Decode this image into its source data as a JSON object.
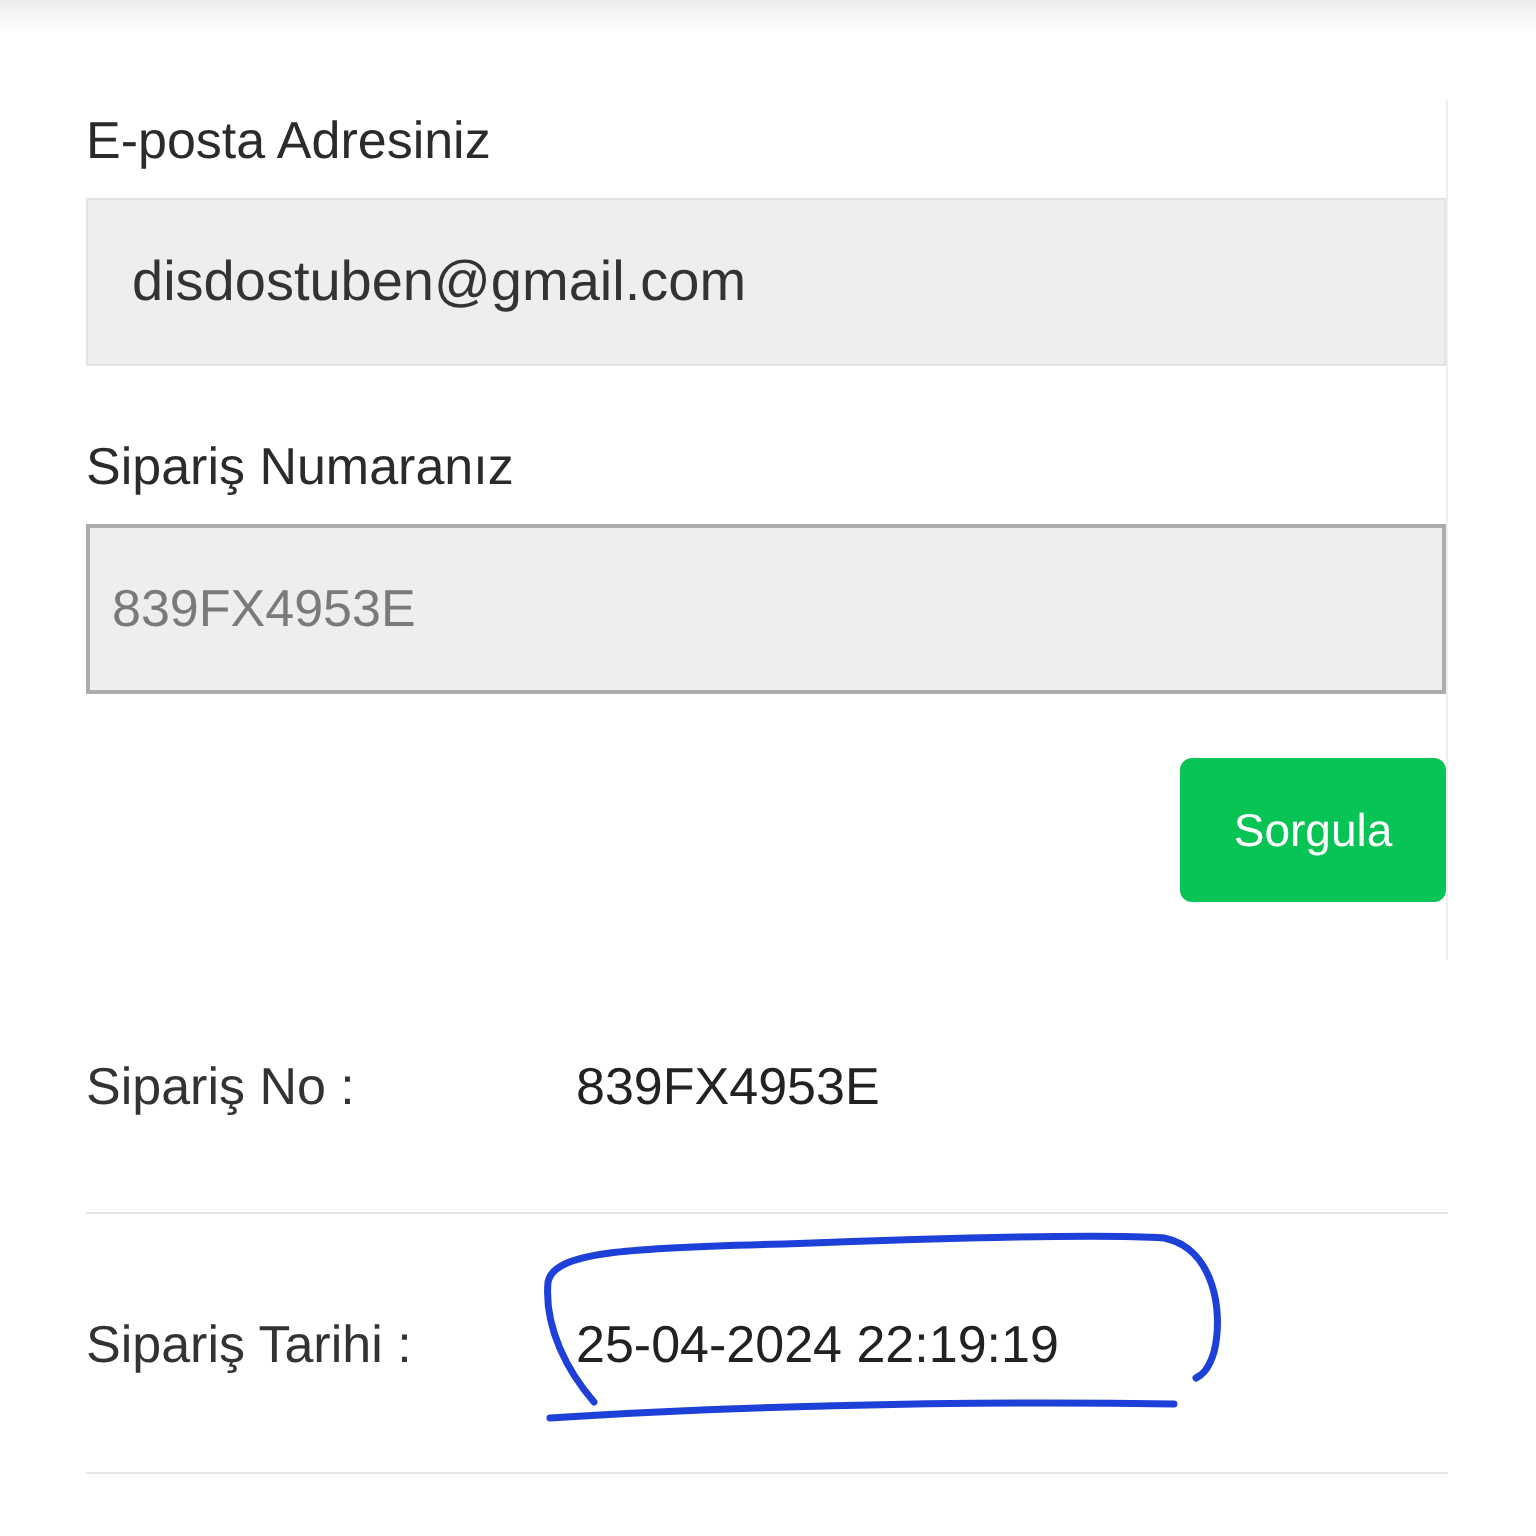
{
  "form": {
    "fields": [
      {
        "kind": "readonly",
        "label": "E-posta Adresiniz",
        "value": "disdostuben@gmail.com"
      },
      {
        "kind": "text",
        "label": "Sipariş Numaranız",
        "placeholder": "839FX4953E"
      }
    ],
    "submit_button": "Sorgula"
  },
  "order_details": [
    {
      "label": "Sipariş No :",
      "value": "839FX4953E",
      "circled": false
    },
    {
      "label": "Sipariş Tarihi :",
      "value": "25-04-2024 22:19:19",
      "circled": true
    }
  ]
}
